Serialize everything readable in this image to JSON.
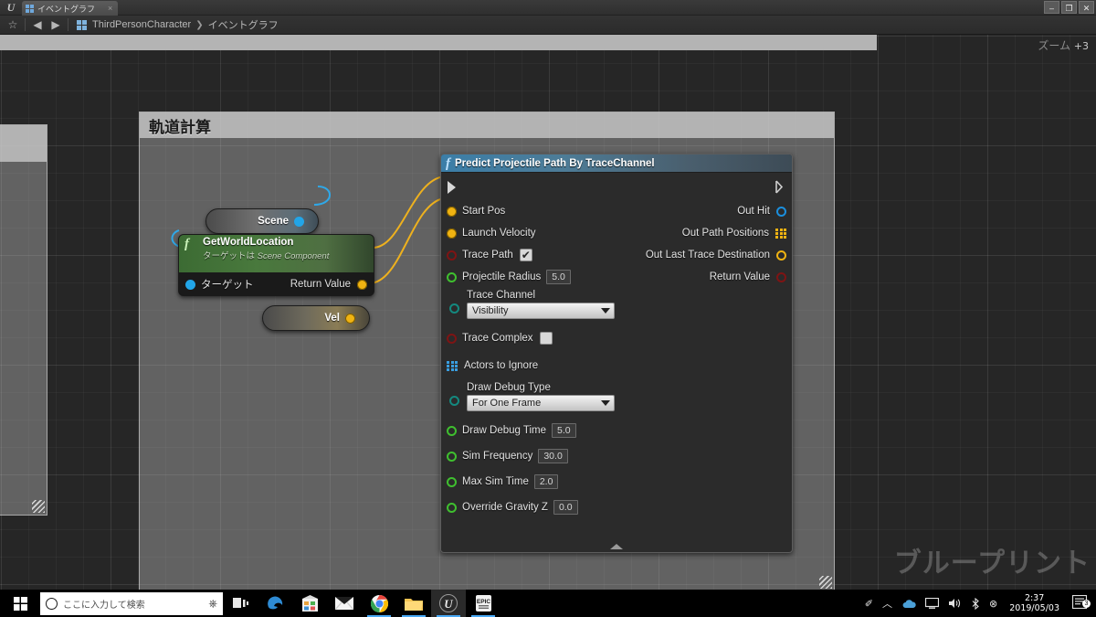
{
  "window": {
    "app_logo": "unreal-engine-logo",
    "tab_label": "イベントグラフ",
    "tab_close": "×",
    "minimize": "–",
    "maximize": "❐",
    "close": "✕"
  },
  "breadcrumb": {
    "favorite_icon": "☆",
    "back_icon": "◀",
    "forward_icon": "▶",
    "blueprint_icon": "blueprint-grid-icon",
    "root": "ThirdPersonCharacter",
    "arrow": "❯",
    "current": "イベントグラフ"
  },
  "canvas": {
    "zoom_prefix": "ズーム",
    "zoom_level": "+3",
    "watermark": "ブループリント"
  },
  "comments": [
    {
      "title": "軌道計算"
    },
    {
      "title": ""
    }
  ],
  "nodes": {
    "predict": {
      "title": "Predict Projectile Path By TraceChannel",
      "fn_glyph": "f",
      "inputs": [
        {
          "label": "Start Pos",
          "pin": "filled-yellow",
          "value": null
        },
        {
          "label": "Launch Velocity",
          "pin": "filled-yellow",
          "value": null
        },
        {
          "label": "Trace Path",
          "pin": "filled-red",
          "checkbox": true
        },
        {
          "label": "Projectile Radius",
          "pin": "hollow-green",
          "value": "5.0"
        },
        {
          "label": "Trace Channel",
          "pin": "hollow-teal",
          "combo": "Visibility"
        },
        {
          "label": "Trace Complex",
          "pin": "filled-red",
          "checkbox": false
        },
        {
          "label": "Actors to Ignore",
          "pin": "array-blue",
          "value": null
        },
        {
          "label": "Draw Debug Type",
          "pin": "hollow-teal",
          "combo": "For One Frame"
        },
        {
          "label": "Draw Debug Time",
          "pin": "hollow-green",
          "value": "5.0"
        },
        {
          "label": "Sim Frequency",
          "pin": "hollow-green",
          "value": "30.0"
        },
        {
          "label": "Max Sim Time",
          "pin": "hollow-green",
          "value": "2.0"
        },
        {
          "label": "Override Gravity Z",
          "pin": "hollow-green",
          "value": "0.0"
        }
      ],
      "outputs": [
        {
          "label": "Out Hit",
          "pin": "hollow-blue"
        },
        {
          "label": "Out Path Positions",
          "pin": "array-yellow"
        },
        {
          "label": "Out Last Trace Destination",
          "pin": "hollow-yellow"
        },
        {
          "label": "Return Value",
          "pin": "hollow-darkred"
        }
      ],
      "collapse_icon": "▲"
    },
    "getworldlocation": {
      "title": "GetWorldLocation",
      "fn_glyph": "f",
      "subtitle_prefix": "ターゲットは ",
      "subtitle_target": "Scene Component",
      "input_label": "ターゲット",
      "output_label": "Return Value"
    },
    "knot_scene": {
      "label": "Scene"
    },
    "knot_vel": {
      "label": "Vel"
    }
  },
  "taskbar": {
    "start_icon": "windows-logo",
    "search_placeholder": "ここに入力して検索",
    "mic_icon": "🎤",
    "items": [
      {
        "name": "task-view-icon",
        "glyph": "▤"
      },
      {
        "name": "edge-icon",
        "glyph": "e"
      },
      {
        "name": "store-icon",
        "glyph": "▣"
      },
      {
        "name": "mail-icon",
        "glyph": "✉"
      },
      {
        "name": "chrome-icon",
        "glyph": "◉"
      },
      {
        "name": "file-explorer-icon",
        "glyph": "▤"
      },
      {
        "name": "unreal-engine-icon",
        "glyph": "U"
      },
      {
        "name": "epic-games-icon",
        "glyph": "E"
      }
    ],
    "tray": [
      {
        "name": "pen-icon",
        "glyph": "✐"
      },
      {
        "name": "chevron-up-icon",
        "glyph": "︿"
      },
      {
        "name": "onedrive-icon",
        "glyph": "☁"
      },
      {
        "name": "network-icon",
        "glyph": "🖳"
      },
      {
        "name": "volume-icon",
        "glyph": "🔊"
      },
      {
        "name": "bluetooth-icon",
        "glyph": "ᛒ"
      },
      {
        "name": "error-icon",
        "glyph": "⊗"
      }
    ],
    "clock_time": "2:37",
    "clock_date": "2019/05/03",
    "notification_icon": "▤",
    "notification_count": "3"
  }
}
